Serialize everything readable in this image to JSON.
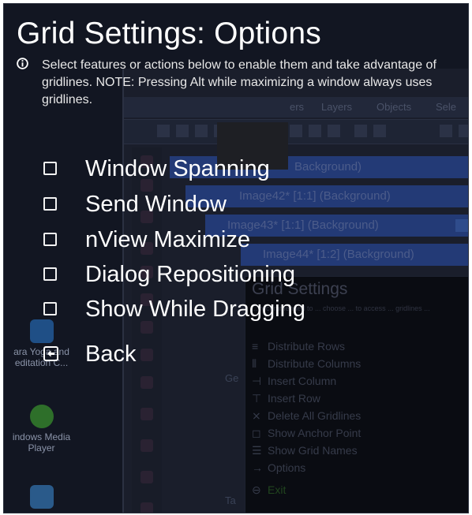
{
  "overlay": {
    "title": "Grid Settings: Options",
    "info": "Select features or actions below to enable them and take advantage of gridlines. NOTE: Pressing Alt while maximizing a window always uses gridlines.",
    "options": [
      {
        "label": "Window Spanning",
        "checked": false
      },
      {
        "label": "Send Window",
        "checked": false
      },
      {
        "label": "nView Maximize",
        "checked": false
      },
      {
        "label": "Dialog Repositioning",
        "checked": false
      },
      {
        "label": "Show While Dragging",
        "checked": false
      }
    ],
    "back_label": "Back",
    "icons": {
      "info": "info-icon",
      "checkbox": "checkbox-icon",
      "back": "back-arrow-icon"
    }
  },
  "background": {
    "desktop_icons": [
      {
        "label": "ara Yoga and\neditation C..."
      },
      {
        "label": "indows Media\nPlayer"
      },
      {
        "label": ""
      }
    ],
    "menu": [
      "ers",
      "Layers",
      "Objects",
      "Sele"
    ],
    "windows": [
      {
        "title": "Background)"
      },
      {
        "title": "Image42* [1:1] (Background)"
      },
      {
        "title": "Image43* [1:1] (Background)"
      },
      {
        "title": "Image44* [1:2] (Background)"
      }
    ],
    "dialog": {
      "title": "Grid Settings",
      "subtitle": "... recommended to ... choose ... to access ... gridlines ...",
      "items": [
        {
          "mark": "≡",
          "label": "Distribute Rows"
        },
        {
          "mark": "⦀",
          "label": "Distribute Columns"
        },
        {
          "mark": "⊣",
          "label": "Insert Column"
        },
        {
          "mark": "⊤",
          "label": "Insert Row"
        },
        {
          "mark": "⨯",
          "label": "Delete All Gridlines"
        },
        {
          "mark": "◻",
          "label": "Show Anchor Point"
        },
        {
          "mark": "☰",
          "label": "Show Grid Names"
        },
        {
          "mark": "→",
          "label": "Options"
        },
        {
          "mark": "⊖",
          "label": "Exit"
        }
      ]
    },
    "side_labels": [
      "Ge",
      "Ta"
    ]
  },
  "colors": {
    "frame_bg": "#0b0f1c",
    "text": "#ffffff",
    "title_bar": "#233a76",
    "exit_green": "#21451e"
  }
}
